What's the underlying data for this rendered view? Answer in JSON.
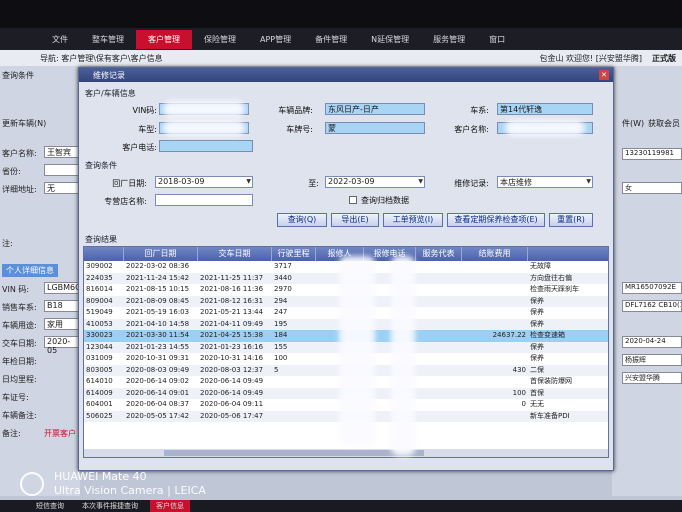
{
  "menu": {
    "items": [
      {
        "label": "文件",
        "active": false
      },
      {
        "label": "整车管理",
        "active": false
      },
      {
        "label": "客户管理",
        "active": true
      },
      {
        "label": "保险管理",
        "active": false
      },
      {
        "label": "APP管理",
        "active": false
      },
      {
        "label": "备件管理",
        "active": false
      },
      {
        "label": "N延保管理",
        "active": false
      },
      {
        "label": "服务管理",
        "active": false
      },
      {
        "label": "窗口",
        "active": false
      }
    ]
  },
  "nav": {
    "breadcrumb": "导航: 客户管理\\保有客户\\客户信息",
    "user": "包金山 欢迎您! [兴安盟华腾]",
    "version": "正式版"
  },
  "left": {
    "search_cond": "查询条件",
    "update_vin": "更新车辆(N)",
    "cust_name_lbl": "客户名称:",
    "cust_name_val": "王智宾",
    "province_lbl": "省份:",
    "addr_lbl": "详细地址:",
    "addr_val": "无",
    "note_lbl": "注:",
    "personal_tab": "个人详细信息",
    "vin_lbl": "VIN 码:",
    "vin_val": "LGBM6C8",
    "series_lbl": "销售车系:",
    "series_val": "B18",
    "usage_lbl": "车辆用途:",
    "usage_val": "家用",
    "delivery_lbl": "交车日期:",
    "delivery_val": "2020-05",
    "yearly_lbl": "年检日期:",
    "daily_lbl": "日均里程:",
    "cert_lbl": "车证号:",
    "source_lbl": "车辆备注:",
    "remark_lbl": "备注:",
    "remark_val": "开票客户"
  },
  "right": {
    "link1": "件(W)",
    "link2": "获取会员",
    "phone": "13230119981",
    "gender": "女",
    "code1": "MR16507092E",
    "code2": "DFL7162 CB10(1",
    "date": "2020-04-24",
    "staff": "杨振辉",
    "dealer": "兴安盟华腾"
  },
  "dialog": {
    "title": "维修记录",
    "sec_customer": "客户/车辆信息",
    "vin_lbl": "VIN码:",
    "brand_lbl": "车辆品牌:",
    "brand_val": "东风日产-日产",
    "series_lbl": "车系:",
    "series_val": "第14代轩逸",
    "model_lbl": "车型:",
    "plate_lbl": "车牌号:",
    "plate_val": "蒙",
    "cust_lbl": "客户名称:",
    "phone_lbl": "客户电话:",
    "sec_query": "查询条件",
    "return_date_lbl": "回厂日期:",
    "date_from": "2018-03-09",
    "to_lbl": "至:",
    "date_to": "2022-03-09",
    "record_lbl": "维修记录:",
    "record_val": "本店维修",
    "advisor_lbl": "专营店名称:",
    "archive_label": "查询归档数据",
    "btn_query": "查询(Q)",
    "btn_export": "导出(E)",
    "btn_workorder": "工单预览(I)",
    "btn_maint": "查看定期保养检查项(E)",
    "btn_reset": "重置(R)",
    "sec_result": "查询结果",
    "columns": [
      "",
      "回厂日期",
      "交车日期",
      "行驶里程",
      "报修人",
      "报修电话",
      "服务代表",
      "结账费用",
      ""
    ],
    "rows": [
      [
        "309002",
        "2022-03-02 08:36",
        "",
        "3717",
        "",
        "",
        "",
        "",
        "无故障"
      ],
      [
        "224035",
        "2021-11-24 15:42",
        "2021-11-25 11:37",
        "3440",
        "",
        "",
        "",
        "",
        "方向盘往右偏"
      ],
      [
        "816014",
        "2021-08-15 10:15",
        "2021-08-16 11:36",
        "2970",
        "",
        "",
        "",
        "",
        "检查雨天踩刹车"
      ],
      [
        "809004",
        "2021-08-09 08:45",
        "2021-08-12 16:31",
        "294",
        "",
        "",
        "",
        "",
        "保养"
      ],
      [
        "519049",
        "2021-05-19 16:03",
        "2021-05-21 13:44",
        "247",
        "",
        "",
        "",
        "",
        "保养"
      ],
      [
        "410053",
        "2021-04-10 14:58",
        "2021-04-11 09:49",
        "195",
        "",
        "",
        "",
        "",
        "保养"
      ],
      [
        "330023",
        "2021-03-30 11:54",
        "2021-04-25 15:38",
        "184",
        "",
        "",
        "",
        "24637.22",
        "检查变速箱"
      ],
      [
        "123044",
        "2021-01-23 14:55",
        "2021-01-23 16:16",
        "155",
        "",
        "",
        "",
        "",
        "保养"
      ],
      [
        "031009",
        "2020-10-31 09:31",
        "2020-10-31 14:16",
        "100",
        "",
        "",
        "",
        "",
        "保养"
      ],
      [
        "803005",
        "2020-08-03 09:49",
        "2020-08-03 12:37",
        "5",
        "",
        "",
        "",
        "430",
        "二保"
      ],
      [
        "614010",
        "2020-06-14 09:02",
        "2020-06-14 09:49",
        "",
        "",
        "",
        "",
        "",
        "首保装防爆网"
      ],
      [
        "614009",
        "2020-06-14 09:01",
        "2020-06-14 09:49",
        "",
        "",
        "",
        "",
        "100",
        "首保"
      ],
      [
        "604001",
        "2020-06-04 08:37",
        "2020-06-04 09:11",
        "",
        "",
        "",
        "",
        "0",
        "无无"
      ],
      [
        "506025",
        "2020-05-05 17:42",
        "2020-05-06 17:47",
        "",
        "",
        "",
        "",
        "",
        "新车准备PDI"
      ]
    ],
    "selected_row": 6
  },
  "taskbar": {
    "items": [
      {
        "label": "短信查询",
        "active": false
      },
      {
        "label": "本次事件报捷查询",
        "active": false
      },
      {
        "label": "客户信息",
        "active": true
      }
    ]
  },
  "watermark": {
    "line1": "HUAWEI Mate 40",
    "line2": "Ultra Vision Camera | LEICA"
  },
  "colors": {
    "accent": "#c8102e",
    "header": "#4c62a8",
    "selected": "#9ad0f4",
    "field": "#a9d5f5"
  }
}
